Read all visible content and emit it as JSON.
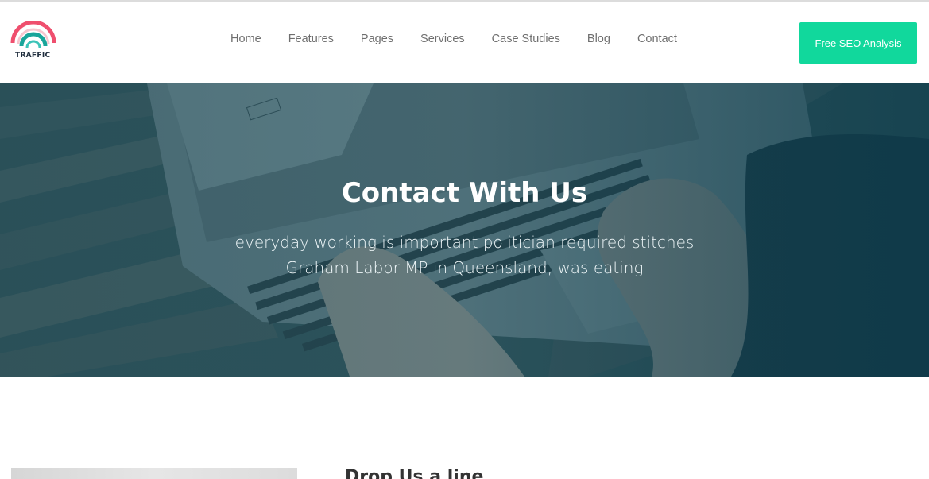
{
  "brand": {
    "name": "TRAFFIC"
  },
  "nav": {
    "items": [
      {
        "label": "Home"
      },
      {
        "label": "Features"
      },
      {
        "label": "Pages"
      },
      {
        "label": "Services"
      },
      {
        "label": "Case Studies"
      },
      {
        "label": "Blog"
      },
      {
        "label": "Contact"
      }
    ]
  },
  "cta": {
    "label": "Free SEO Analysis",
    "color": "#11d89c"
  },
  "hero": {
    "title": "Contact With Us",
    "subtitle_line1": "everyday working is important politician required stitches",
    "subtitle_line2": "Graham Labor MP in Queensland, was eating"
  },
  "contact_form": {
    "title": "Drop Us a line"
  },
  "colors": {
    "accent": "#11d89c",
    "logo_red": "#ef4f6e",
    "logo_teal": "#1aa59a"
  }
}
